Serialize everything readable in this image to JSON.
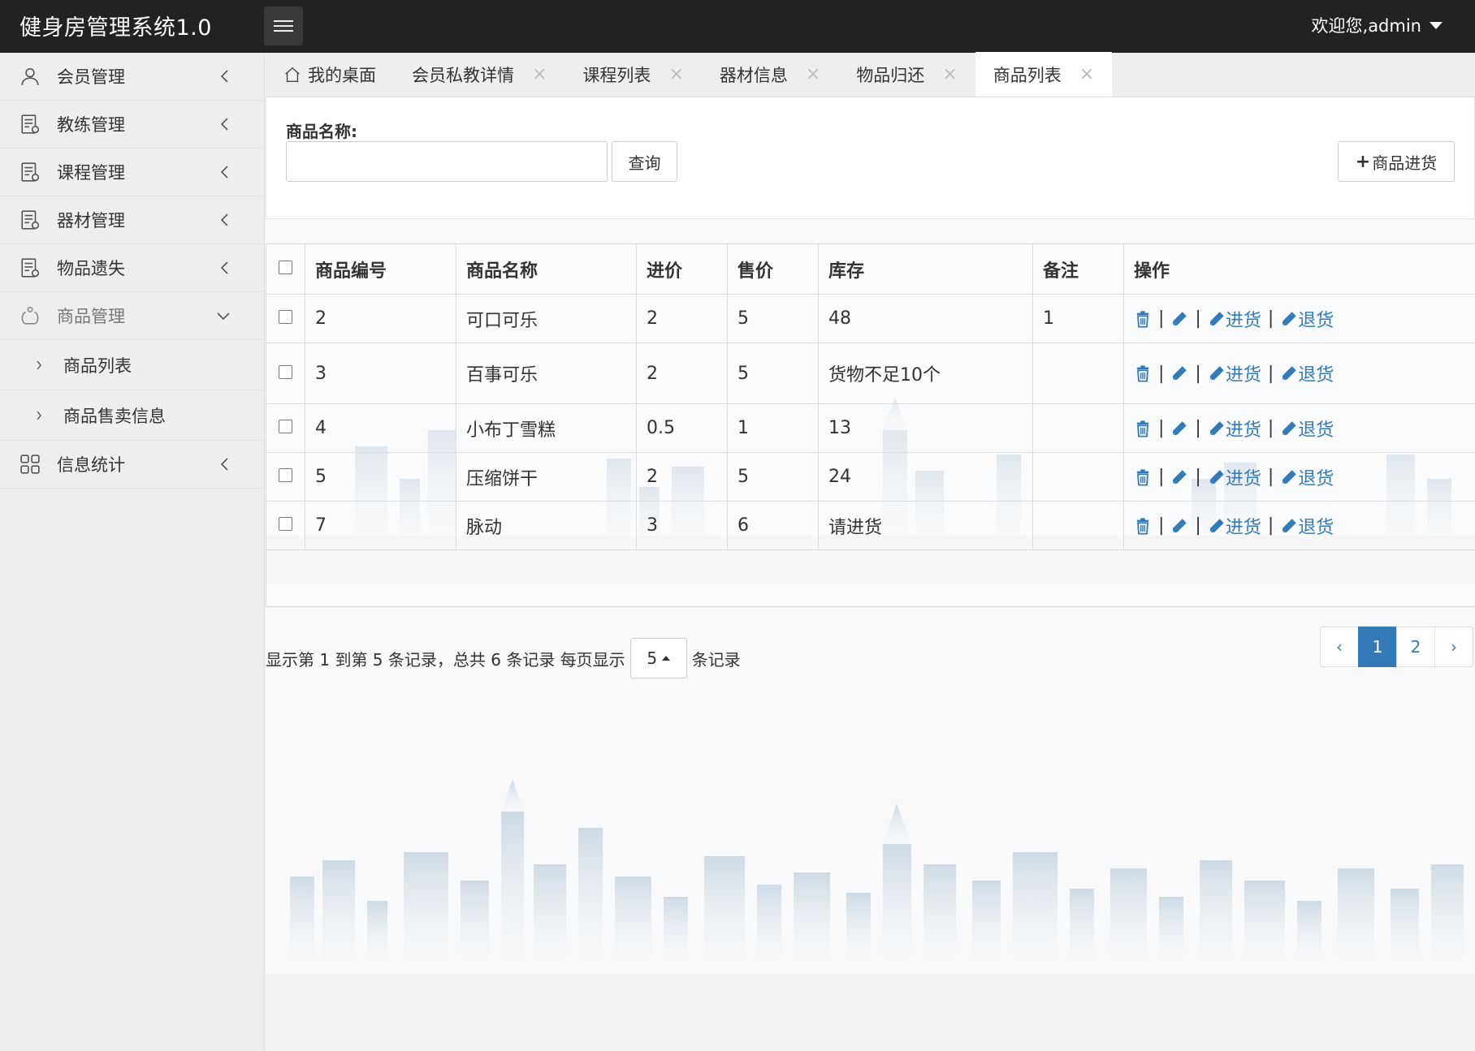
{
  "header": {
    "app_title": "健身房管理系统1.0",
    "user_menu": "欢迎您,admin"
  },
  "sidebar": {
    "items": [
      {
        "label": "会员管理",
        "icon": "user-icon"
      },
      {
        "label": "教练管理",
        "icon": "document-icon"
      },
      {
        "label": "课程管理",
        "icon": "document-icon"
      },
      {
        "label": "器材管理",
        "icon": "document-icon"
      },
      {
        "label": "物品遗失",
        "icon": "document-icon"
      },
      {
        "label": "商品管理",
        "icon": "goods-icon",
        "expanded": true
      },
      {
        "label": "信息统计",
        "icon": "grid-icon"
      }
    ],
    "sub_items": [
      {
        "label": "商品列表"
      },
      {
        "label": "商品售卖信息"
      }
    ]
  },
  "tabs": [
    {
      "label": "我的桌面",
      "closable": false,
      "icon": "home-icon"
    },
    {
      "label": "会员私教详情",
      "closable": true
    },
    {
      "label": "课程列表",
      "closable": true
    },
    {
      "label": "器材信息",
      "closable": true
    },
    {
      "label": "物品归还",
      "closable": true
    },
    {
      "label": "商品列表",
      "closable": true,
      "active": true
    }
  ],
  "tab_close_glyph": "×",
  "search": {
    "label": "商品名称:",
    "value": "",
    "placeholder": "",
    "query_button": "查询",
    "stock_button": "商品进货"
  },
  "table": {
    "headers": [
      "商品编号",
      "商品名称",
      "进价",
      "售价",
      "库存",
      "备注",
      "操作"
    ],
    "rows": [
      {
        "id": "2",
        "name": "可口可乐",
        "cost": "2",
        "price": "5",
        "stock": "48",
        "stock_warning": false,
        "remark": "1"
      },
      {
        "id": "3",
        "name": "百事可乐",
        "cost": "2",
        "price": "5",
        "stock": "货物不足10个",
        "stock_warning": true,
        "remark": ""
      },
      {
        "id": "4",
        "name": "小布丁雪糕",
        "cost": "0.5",
        "price": "1",
        "stock": "13",
        "stock_warning": false,
        "remark": ""
      },
      {
        "id": "5",
        "name": "压缩饼干",
        "cost": "2",
        "price": "5",
        "stock": "24",
        "stock_warning": false,
        "remark": ""
      },
      {
        "id": "7",
        "name": "脉动",
        "cost": "3",
        "price": "6",
        "stock": "请进货",
        "stock_warning": true,
        "remark": ""
      }
    ],
    "op_restock": "进货",
    "op_return": "退货",
    "op_separator": "|"
  },
  "pagination": {
    "info_prefix": "显示第 1 到第 5 条记录，总共 6 条记录 每页显示",
    "page_size": "5",
    "info_suffix": "条记录",
    "prev": "‹",
    "pages": [
      "1",
      "2"
    ],
    "active_page": "1",
    "next": "›"
  },
  "colors": {
    "topbar": "#222222",
    "link": "#337ab7",
    "warning": "#ee0000",
    "active_page": "#337ab7"
  }
}
